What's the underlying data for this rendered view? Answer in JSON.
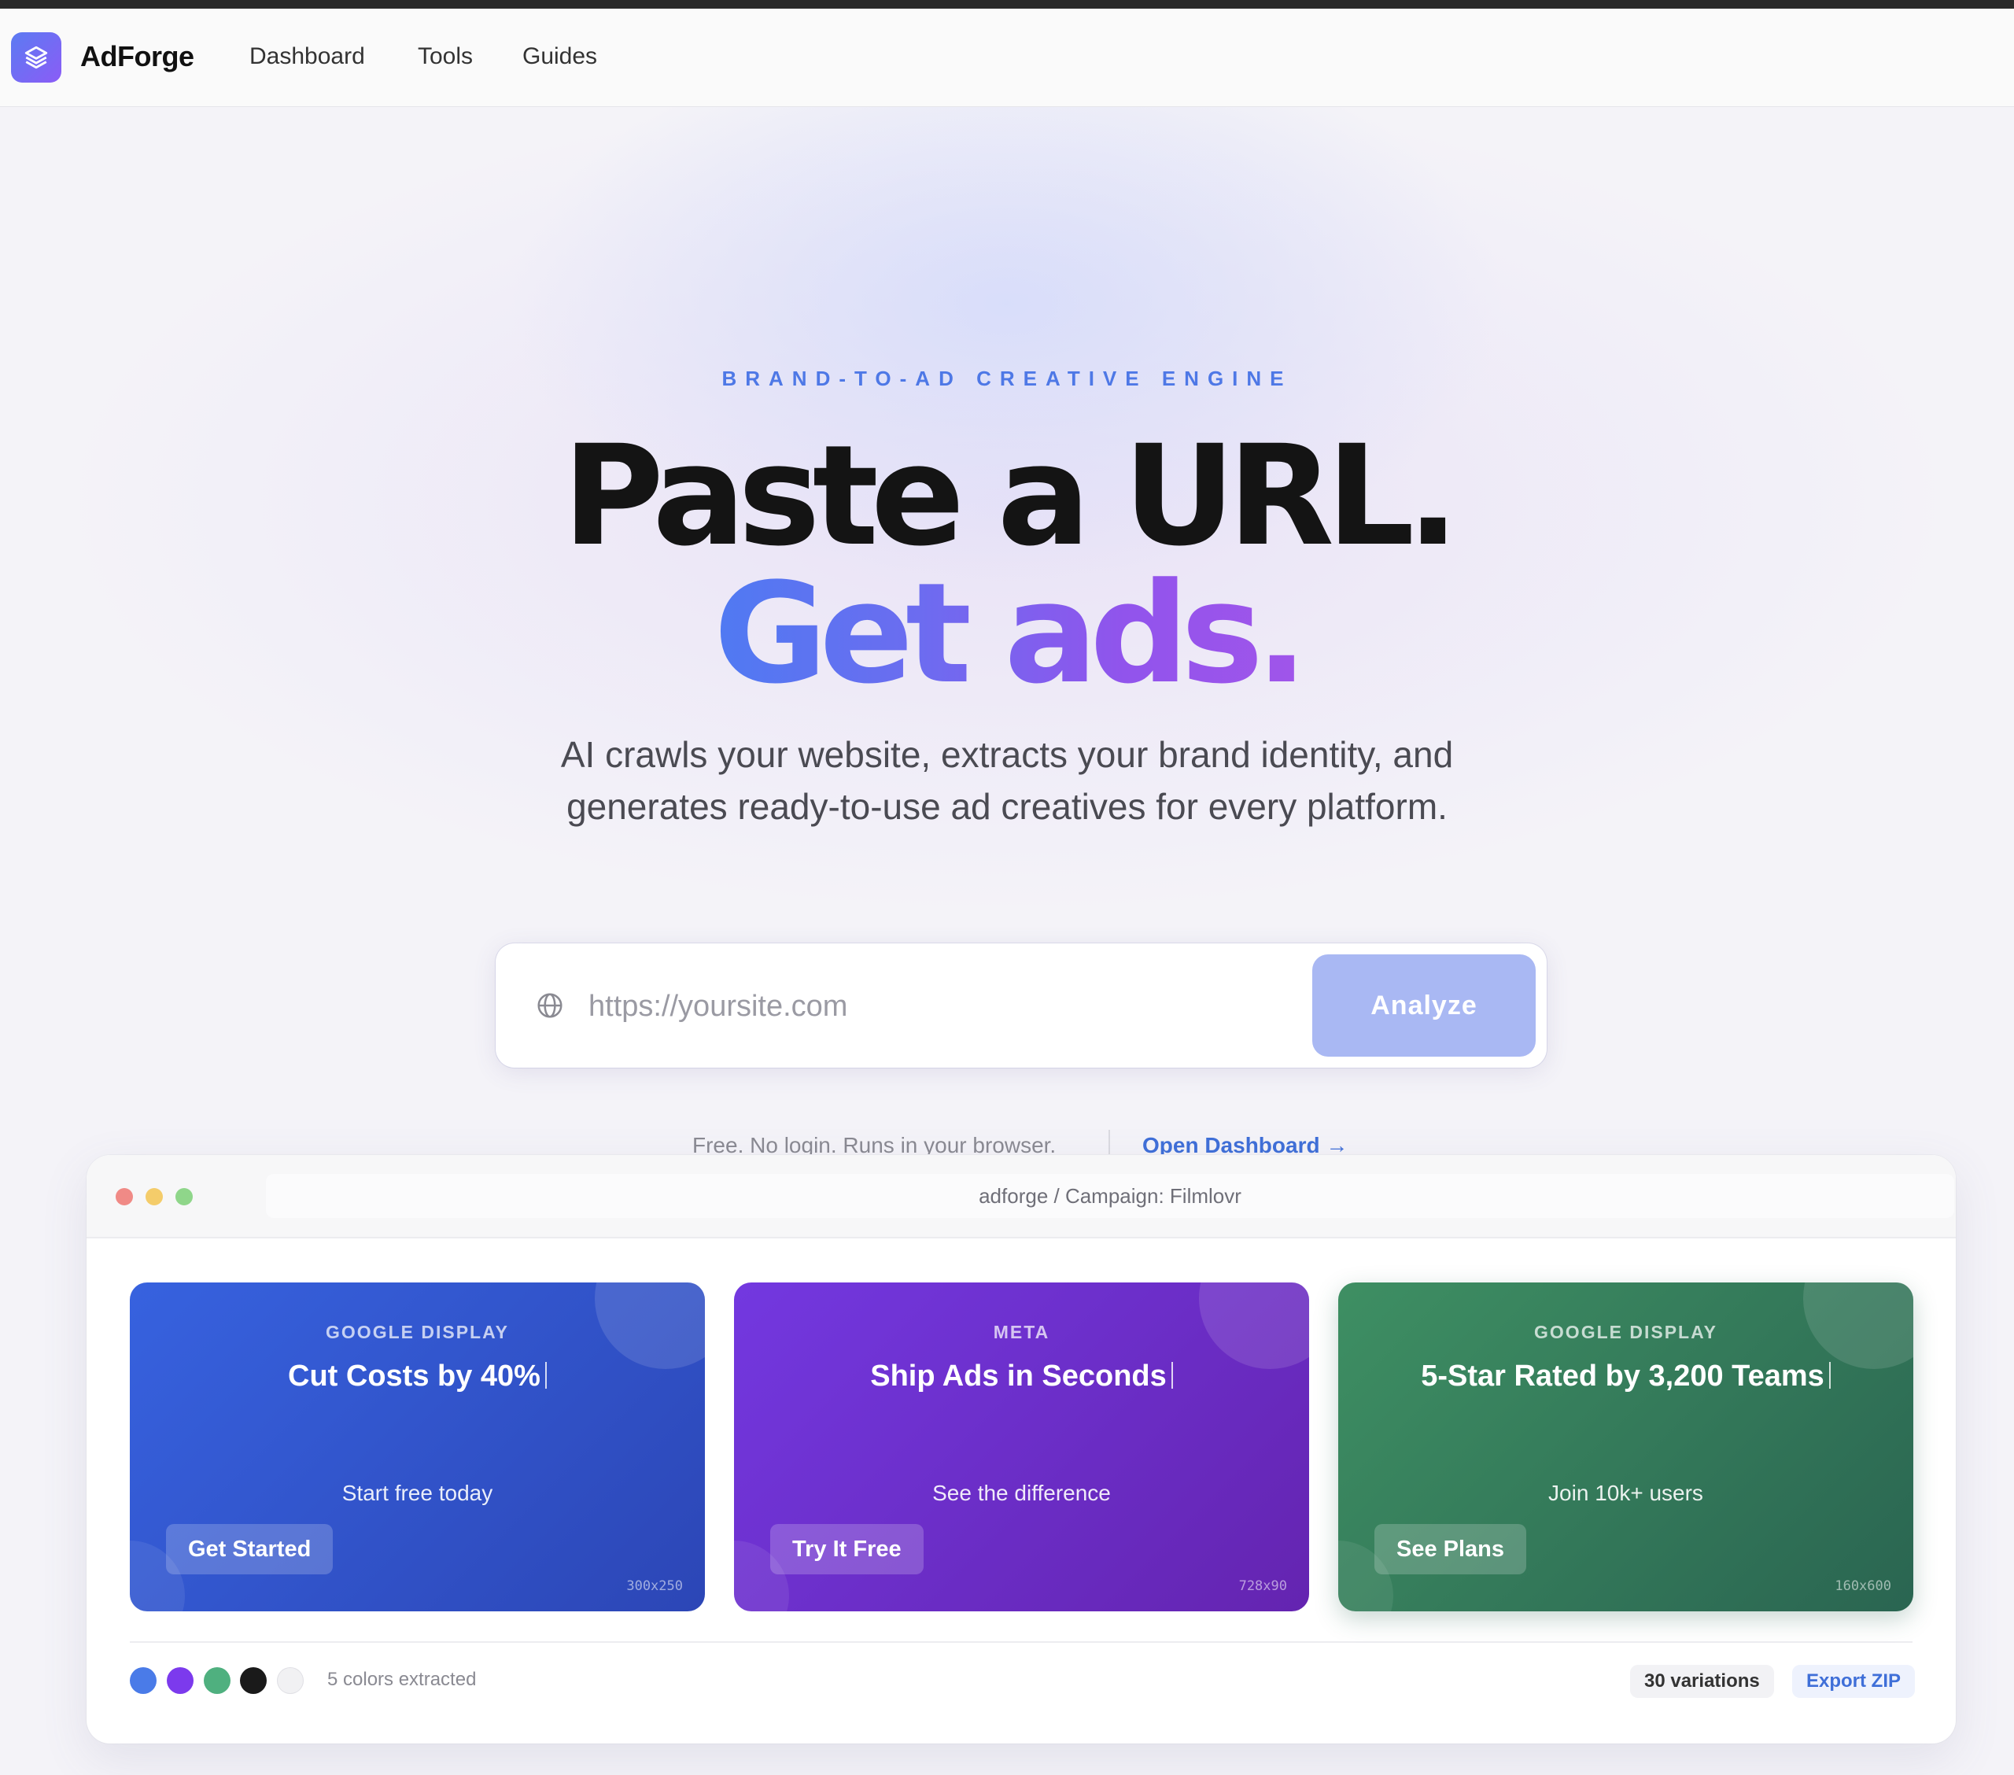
{
  "app": {
    "brand": "AdForge"
  },
  "nav": {
    "items": [
      "Dashboard",
      "Tools",
      "Guides"
    ]
  },
  "hero": {
    "eyebrow": "BRAND-TO-AD CREATIVE ENGINE",
    "headline_line1": "Paste a URL.",
    "headline_line2": "Get ads.",
    "subtitle": "AI crawls your website, extracts your brand identity, and generates ready-to-use ad creatives for every platform.",
    "url_placeholder": "https://yoursite.com",
    "url_value": "",
    "analyze_label": "Analyze",
    "note": "Free. No login. Runs in your browser.",
    "open_dashboard_label": "Open Dashboard →"
  },
  "preview": {
    "address": "adforge / Campaign: Filmlovr",
    "cards": [
      {
        "platform": "GOOGLE DISPLAY",
        "headline": "Cut Costs by 40%",
        "tagline": "Start free today",
        "cta": "Get Started",
        "size": "300x250"
      },
      {
        "platform": "META",
        "headline": "Ship Ads in Seconds",
        "tagline": "See the difference",
        "cta": "Try It Free",
        "size": "728x90"
      },
      {
        "platform": "GOOGLE DISPLAY",
        "headline": "5-Star Rated by 3,200 Teams",
        "tagline": "Join 10k+ users",
        "cta": "See Plans",
        "size": "160x600"
      }
    ],
    "palette": [
      "#4a7be8",
      "#7c3aed",
      "#4fb07f",
      "#1a1a1a",
      "#f1f1f3"
    ],
    "colors_label": "5 colors extracted",
    "variations_label": "30 variations",
    "export_label": "Export ZIP"
  },
  "colors": {
    "accent_blue": "#4e78e6",
    "analyze_button": "#a9b8f3",
    "card_blue": "#3762df",
    "card_purple": "#7338e0",
    "card_green": "#3e8f63"
  },
  "icons": {
    "logo": "layers-icon",
    "url_field": "globe-icon"
  }
}
